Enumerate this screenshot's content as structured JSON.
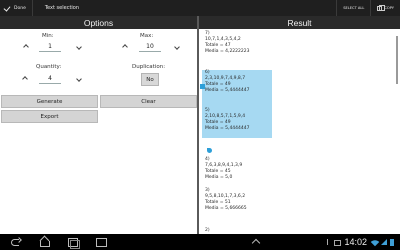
{
  "action_bar": {
    "done_label": "Done",
    "title": "Text selection",
    "select_all_label": "SELECT ALL",
    "copy_label": "COPY"
  },
  "options_panel": {
    "header": "Options",
    "min": {
      "label": "Min:",
      "value": "1"
    },
    "max": {
      "label": "Max:",
      "value": "10"
    },
    "quantity": {
      "label": "Quantity:",
      "value": "4"
    },
    "duplication": {
      "label": "Duplication:",
      "value": "No"
    },
    "generate_label": "Generate",
    "clear_label": "Clear",
    "export_label": "Export"
  },
  "result_panel": {
    "header": "Result",
    "blocks": [
      {
        "text": "7)\n10,7,1,4,3,5,4,2\nTotale = 47\nMedia = 4,2222223",
        "selected": false
      },
      {
        "text": "6)\n2,3,10,9,7,4,9,8,7\nTotale = 49\nMedia = 5,4444447",
        "selected": true
      },
      {
        "text": "5)\n2,10,8,5,7,1,5,9,4\nTotale = 49\nMedia = 5,4444447",
        "selected": true
      },
      {
        "text": "4)\n7,6,3,8,9,4,1,3,9\nTotale = 45\nMedia = 5,0",
        "selected": false
      },
      {
        "text": "3)\n9,5,8,10,1,7,3,6,2\nTotale = 51\nMedia = 5,666665",
        "selected": false
      },
      {
        "text": "2)",
        "selected": false
      }
    ]
  },
  "system_bar": {
    "time": "14:02"
  }
}
